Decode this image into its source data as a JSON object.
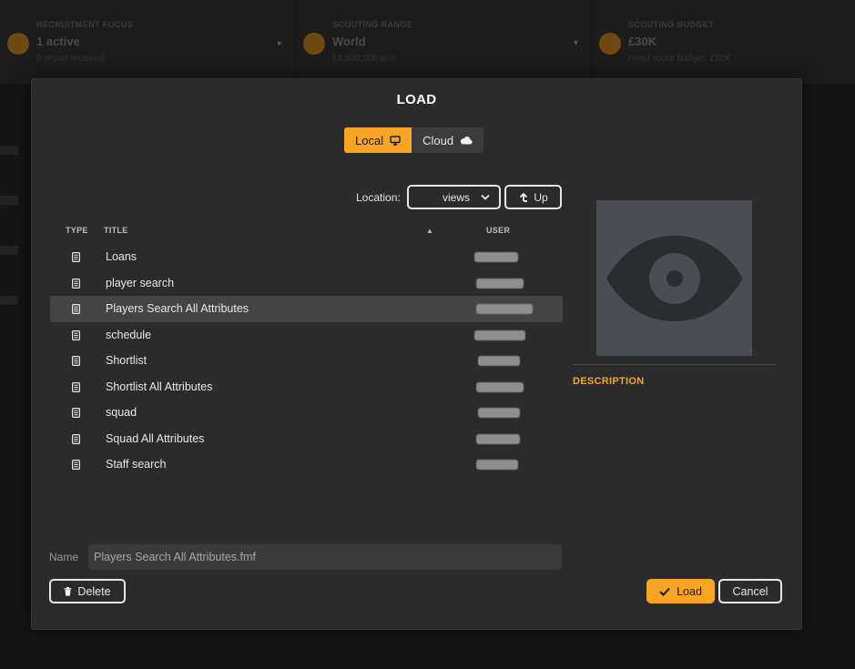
{
  "background": {
    "cards": [
      {
        "label": "RECRUITMENT FOCUS",
        "value": "1 active",
        "sub": "0 report received"
      },
      {
        "label": "SCOUTING RANGE",
        "value": "World",
        "sub": "£4,500,000 p/m"
      },
      {
        "label": "SCOUTING BUDGET",
        "value": "£30K",
        "sub": "Hired scout budget: £50K"
      }
    ]
  },
  "dialog": {
    "title": "LOAD",
    "tabs": [
      {
        "label": "Local",
        "icon": "monitor-icon",
        "active": true
      },
      {
        "label": "Cloud",
        "icon": "cloud-icon",
        "active": false
      }
    ],
    "location_label": "Location:",
    "location_value": "views",
    "up_label": "Up",
    "columns": {
      "type": "TYPE",
      "title": "TITLE",
      "user": "USER"
    },
    "files": [
      {
        "title": "Loans",
        "selected": false
      },
      {
        "title": "player search",
        "selected": false
      },
      {
        "title": "Players Search All Attributes",
        "selected": true
      },
      {
        "title": "schedule",
        "selected": false
      },
      {
        "title": "Shortlist",
        "selected": false
      },
      {
        "title": "Shortlist All Attributes",
        "selected": false
      },
      {
        "title": "squad",
        "selected": false
      },
      {
        "title": "Squad All Attributes",
        "selected": false
      },
      {
        "title": "Staff search",
        "selected": false
      }
    ],
    "preview_icon": "eye-icon",
    "description_label": "DESCRIPTION",
    "name_label": "Name",
    "name_value": "Players Search All Attributes.fmf",
    "delete_label": "Delete",
    "load_label": "Load",
    "cancel_label": "Cancel",
    "accent_color": "#f8a526"
  }
}
